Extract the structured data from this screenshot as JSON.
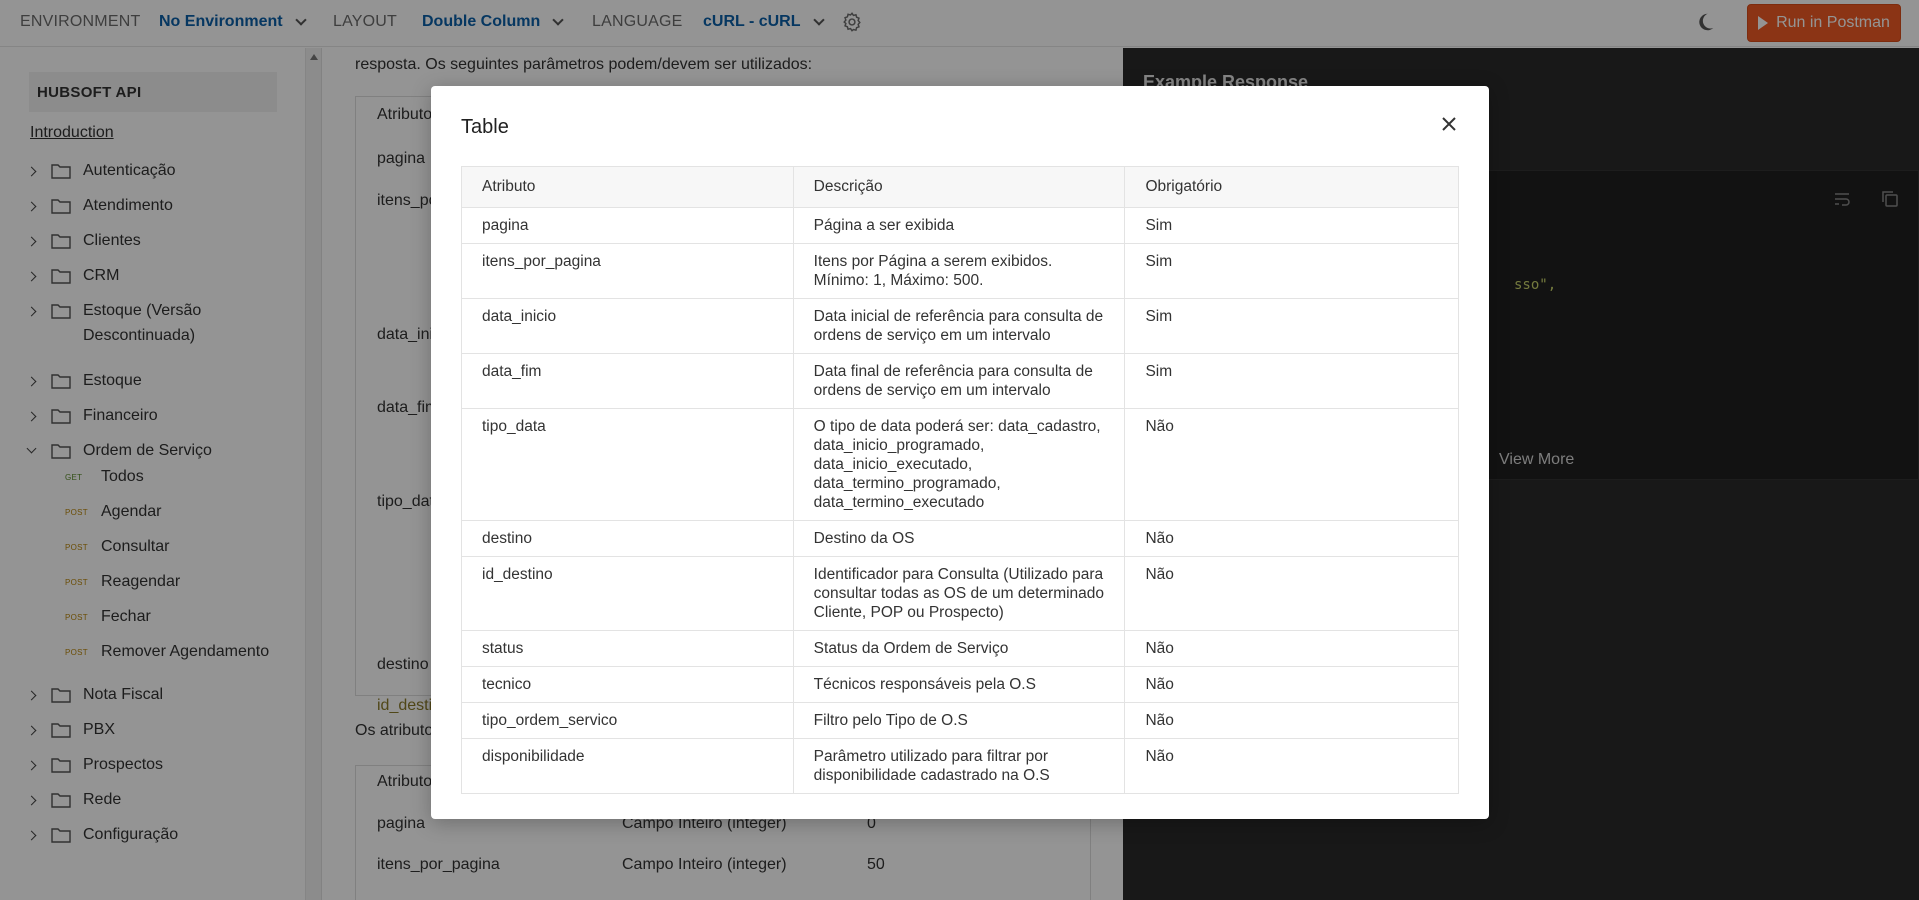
{
  "topbar": {
    "environment_label": "ENVIRONMENT",
    "environment_value": "No Environment",
    "layout_label": "LAYOUT",
    "layout_value": "Double Column",
    "language_label": "LANGUAGE",
    "language_value": "cURL - cURL",
    "run_button": "Run in Postman",
    "accent_color": "#ef5b25",
    "link_color": "#0b5fa8"
  },
  "sidebar": {
    "header": "HUBSOFT API",
    "intro": "Introduction",
    "folders": [
      {
        "label": "Autenticação"
      },
      {
        "label": "Atendimento"
      },
      {
        "label": "Clientes"
      },
      {
        "label": "CRM"
      },
      {
        "label": "Estoque (Versão",
        "label2": "Descontinuada)"
      },
      {
        "label": "Estoque"
      },
      {
        "label": "Financeiro"
      },
      {
        "label": "Ordem de Serviço"
      },
      {
        "label": "Nota Fiscal"
      },
      {
        "label": "PBX"
      },
      {
        "label": "Prospectos"
      },
      {
        "label": "Rede"
      },
      {
        "label": "Configuração"
      }
    ],
    "requests": [
      {
        "method": "GET",
        "label": "Todos"
      },
      {
        "method": "POST",
        "label": "Agendar"
      },
      {
        "method": "POST",
        "label": "Consultar"
      },
      {
        "method": "POST",
        "label": "Reagendar"
      },
      {
        "method": "POST",
        "label": "Fechar"
      },
      {
        "method": "POST",
        "label": "Remover Agendamento"
      }
    ]
  },
  "center": {
    "intro_text": "resposta. Os seguintes parâmetros podem/devem ser utilizados:",
    "bg_table1_rows": [
      "Atributo",
      "pagina",
      "itens_po",
      "data_ini",
      "data_fim",
      "tipo_dat",
      "destino",
      "id_desti"
    ],
    "attributes_text": "Os atributo",
    "bg_table2": [
      {
        "a": "Atributo",
        "b": "",
        "c": ""
      },
      {
        "a": "pagina",
        "b": "Campo Inteiro (integer)",
        "c": "0"
      },
      {
        "a": "itens_por_pagina",
        "b": "Campo Inteiro (integer)",
        "c": "50"
      }
    ]
  },
  "right": {
    "title": "Example Response",
    "code_fragment": "sso\",",
    "view_more": "View More"
  },
  "modal": {
    "title": "Table",
    "headers": [
      "Atributo",
      "Descrição",
      "Obrigatório"
    ],
    "rows": [
      {
        "attr": "pagina",
        "desc": "Página a ser exibida",
        "req": "Sim"
      },
      {
        "attr": "itens_por_pagina",
        "desc": "Itens por Página a serem exibidos. Mínimo: 1, Máximo: 500.",
        "req": "Sim"
      },
      {
        "attr": "data_inicio",
        "desc": "Data inicial de referência para consulta de ordens de serviço em um intervalo",
        "req": "Sim"
      },
      {
        "attr": "data_fim",
        "desc": "Data final de referência para consulta de ordens de serviço em um intervalo",
        "req": "Sim"
      },
      {
        "attr": "tipo_data",
        "desc": "O tipo de data poderá ser: data_cadastro, data_inicio_programado, data_inicio_executado, data_termino_programado, data_termino_executado",
        "req": "Não"
      },
      {
        "attr": "destino",
        "desc": "Destino da OS",
        "req": "Não"
      },
      {
        "attr": "id_destino",
        "desc": "Identificador para Consulta (Utilizado para consultar todas as OS de um determinado Cliente, POP ou Prospecto)",
        "req": "Não"
      },
      {
        "attr": "status",
        "desc": "Status da Ordem de Serviço",
        "req": "Não"
      },
      {
        "attr": "tecnico",
        "desc": "Técnicos responsáveis pela O.S",
        "req": "Não"
      },
      {
        "attr": "tipo_ordem_servico",
        "desc": "Filtro pelo Tipo de O.S",
        "req": "Não"
      },
      {
        "attr": "disponibilidade",
        "desc": "Parâmetro utilizado para filtrar por disponibilidade cadastrado na O.S",
        "req": "Não"
      }
    ]
  }
}
